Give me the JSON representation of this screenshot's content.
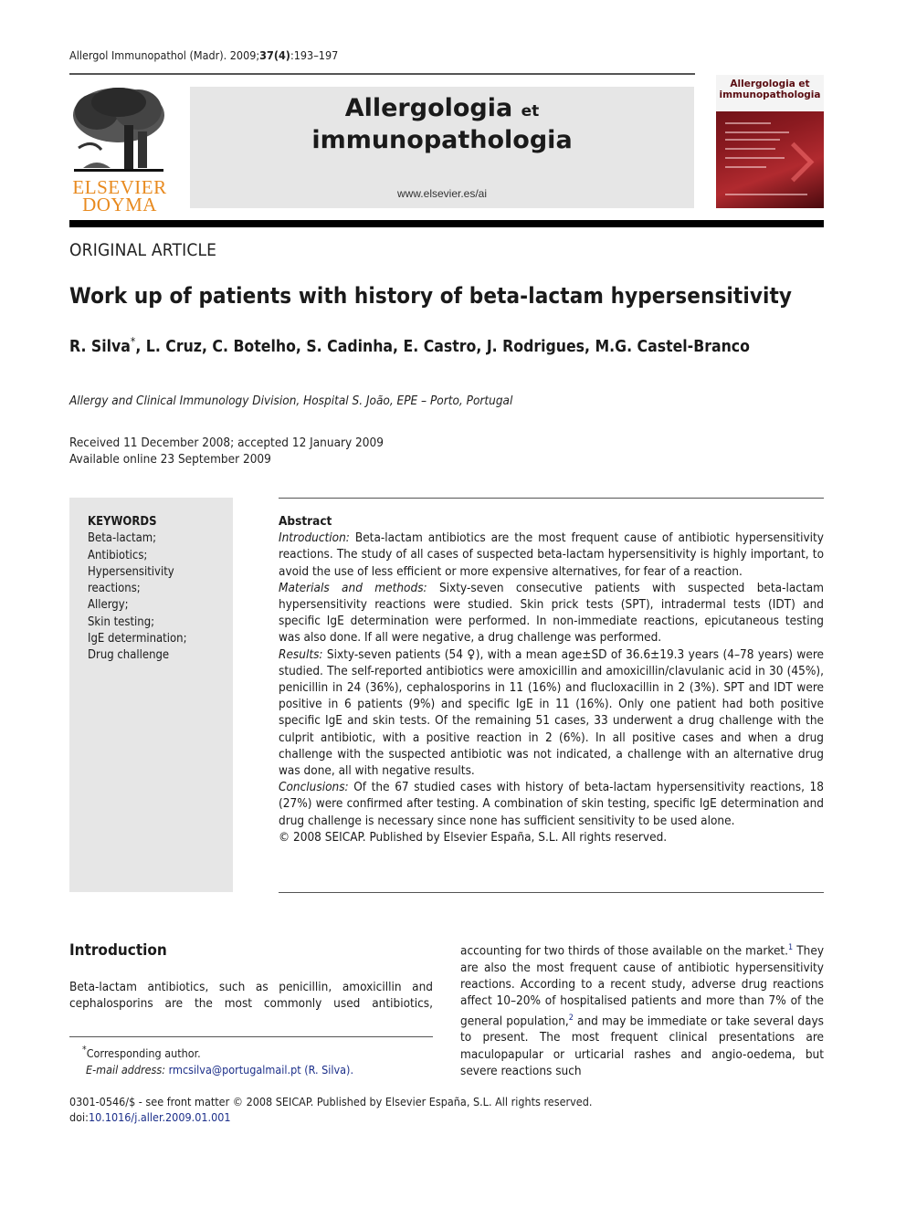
{
  "header": {
    "journal_ref_prefix": "Allergol Immunopathol (Madr). 2009;",
    "journal_ref_volume": "37(4)",
    "journal_ref_pages": ":193–197",
    "publisher_logo_line1": "ELSEVIER",
    "publisher_logo_line2": "DOYMA",
    "banner_title_line1": "Allergologia",
    "banner_title_et": "et",
    "banner_title_line2": "immunopathologia",
    "banner_url": "www.elsevier.es/ai",
    "cover_title_line1": "Allergologia et",
    "cover_title_line2": "immunopathologia"
  },
  "article": {
    "type": "ORIGINAL ARTICLE",
    "title": "Work up of patients with history of beta-lactam hypersensitivity",
    "first_author": "R. Silva",
    "first_author_mark": "*",
    "other_authors": ", L. Cruz, C. Botelho, S. Cadinha, E. Castro, J. Rodrigues, M.G. Castel-Branco",
    "affiliation": "Allergy and Clinical Immunology Division, Hospital S. João, EPE – Porto, Portugal",
    "received": "Received 11 December 2008; accepted 12 January 2009",
    "available": "Available online 23 September 2009"
  },
  "keywords": {
    "title": "KEYWORDS",
    "items": [
      "Beta-lactam;",
      "Antibiotics;",
      "Hypersensitivity reactions;",
      "Allergy;",
      "Skin testing;",
      "IgE determination;",
      "Drug challenge"
    ]
  },
  "abstract": {
    "heading": "Abstract",
    "introduction_label": "Introduction:",
    "introduction_text": " Beta-lactam antibiotics are the most frequent cause of antibiotic hypersensitivity reactions. The study of all cases of suspected beta-lactam hypersensitivity is highly important, to avoid the use of less efficient or more expensive alternatives, for fear of a reaction.",
    "methods_label": "Materials and methods:",
    "methods_text": " Sixty-seven consecutive patients with suspected beta-lactam hypersensitivity reactions were studied. Skin prick tests (SPT), intradermal tests (IDT) and specific IgE determination were performed. In non-immediate reactions, epicutaneous testing was also done. If all were negative, a drug challenge was performed.",
    "results_label": "Results:",
    "results_text": " Sixty-seven patients (54 ♀), with a mean age±SD of 36.6±19.3 years (4–78 years) were studied. The self-reported antibiotics were amoxicillin and amoxicillin/clavulanic acid in 30 (45%), penicillin in 24 (36%), cephalosporins in 11 (16%) and flucloxacillin in 2 (3%). SPT and IDT were positive in 6 patients (9%) and specific IgE in 11 (16%). Only one patient had both positive specific IgE and skin tests. Of the remaining 51 cases, 33 underwent a drug challenge with the culprit antibiotic, with a positive reaction in 2 (6%). In all positive cases and when a drug challenge with the suspected antibiotic was not indicated, a challenge with an alternative drug was done, all with negative results.",
    "conclusions_label": "Conclusions:",
    "conclusions_text": " Of the 67 studied cases with history of beta-lactam hypersensitivity reactions, 18 (27%) were confirmed after testing. A combination of skin testing, specific IgE determination and drug challenge is necessary since none has sufficient sensitivity to be used alone.",
    "copyright": "© 2008 SEICAP. Published by Elsevier España, S.L. All rights reserved."
  },
  "body": {
    "intro_heading": "Introduction",
    "intro_col1": "Beta-lactam antibiotics, such as penicillin, amoxicillin and cephalosporins are the most commonly used antibiotics,",
    "col2_part1": "accounting for two thirds of those available on the market.",
    "col2_ref1": "1",
    "col2_part2": " They are also the most frequent cause of antibiotic hypersensitivity reactions. According to a recent study, adverse drug reactions affect 10–20% of hospitalised patients and more than 7% of the general population,",
    "col2_ref2": "2",
    "col2_part3": " and may be immediate or take several days to present. The most frequent clinical presentations are maculopapular or urticarial rashes and angio-oedema, but severe reactions such"
  },
  "footnote": {
    "mark": "*",
    "corresponding": "Corresponding author.",
    "email_label": "E-mail address:",
    "email": "rmcsilva@portugalmail.pt",
    "email_name": "(R. Silva)."
  },
  "footer": {
    "issn_line": "0301-0546/$ - see front matter © 2008 SEICAP. Published by Elsevier España, S.L. All rights reserved.",
    "doi_label": "doi:",
    "doi": "10.1016/j.aller.2009.01.001"
  }
}
